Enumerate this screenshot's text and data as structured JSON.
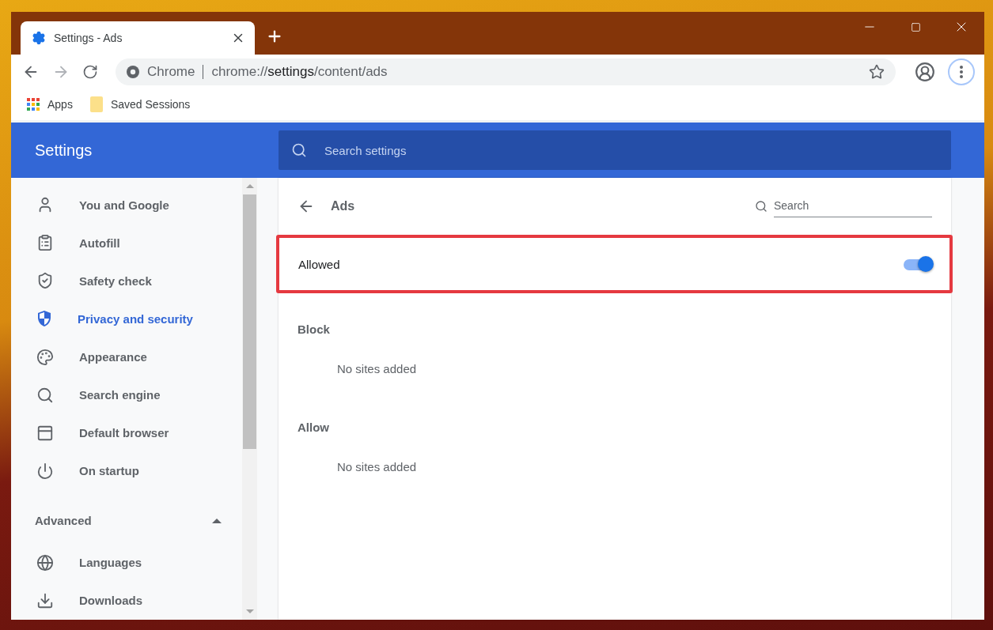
{
  "tab": {
    "title": "Settings - Ads"
  },
  "address_bar": {
    "site_label": "Chrome",
    "url_scheme": "chrome://",
    "url_host": "settings",
    "url_path": "/content/ads"
  },
  "bookmarks": [
    "Apps",
    "Saved Sessions"
  ],
  "header": {
    "title": "Settings",
    "search": {
      "placeholder": "Search settings"
    }
  },
  "sidebar": {
    "items": [
      {
        "label": "You and Google",
        "selected": false
      },
      {
        "label": "Autofill",
        "selected": false
      },
      {
        "label": "Safety check",
        "selected": false
      },
      {
        "label": "Privacy and security",
        "selected": true
      },
      {
        "label": "Appearance",
        "selected": false
      },
      {
        "label": "Search engine",
        "selected": false
      },
      {
        "label": "Default browser",
        "selected": false
      },
      {
        "label": "On startup",
        "selected": false
      }
    ],
    "advanced": {
      "label": "Advanced",
      "expanded": true,
      "items": [
        {
          "label": "Languages",
          "selected": false
        },
        {
          "label": "Downloads",
          "selected": false
        }
      ]
    }
  },
  "page": {
    "title": "Ads",
    "search": {
      "placeholder": "Search"
    },
    "setting": {
      "label": "Allowed",
      "on": true,
      "highlighted": true
    },
    "sections": [
      {
        "title": "Block",
        "empty_text": "No sites added"
      },
      {
        "title": "Allow",
        "empty_text": "No sites added"
      }
    ]
  }
}
